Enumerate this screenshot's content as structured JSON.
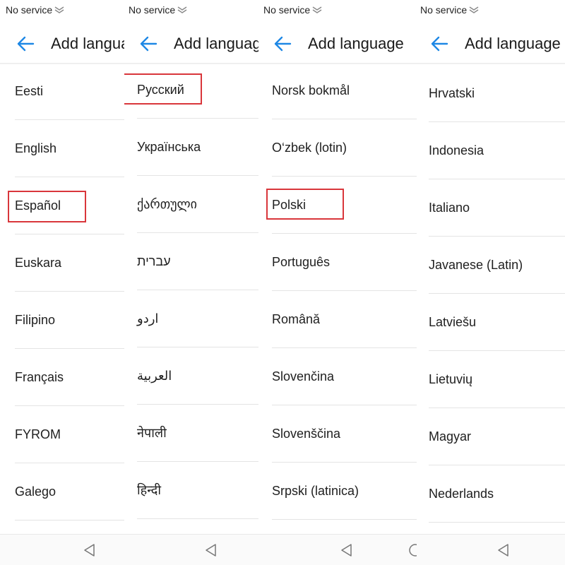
{
  "status_text": "No service",
  "title": "Add language",
  "panels": [
    {
      "items": [
        "Eesti",
        "English",
        "Español",
        "Euskara",
        "Filipino",
        "Français",
        "FYROM",
        "Galego"
      ],
      "highlighted": 2
    },
    {
      "items": [
        "Русский",
        "Українська",
        "ქართული",
        "עברית",
        "اردو",
        "العربية",
        "नेपाली",
        "हिन्दी"
      ],
      "highlighted": 0
    },
    {
      "items": [
        "Norsk bokmål",
        "O‘zbek (lotin)",
        "Polski",
        "Português",
        "Română",
        "Slovenčina",
        "Slovenščina",
        "Srpski (latinica)"
      ],
      "highlighted": 2
    },
    {
      "items": [
        "Hrvatski",
        "Indonesia",
        "Italiano",
        "Javanese (Latin)",
        "Latviešu",
        "Lietuvių",
        "Magyar",
        "Nederlands"
      ],
      "highlighted": null
    }
  ],
  "colors": {
    "accent": "#1e88e5",
    "highlight_box": "#d9363b"
  },
  "icons": {
    "back": "arrow-left-icon",
    "signal": "no-signal-icon",
    "nav_back": "triangle-back-icon"
  }
}
